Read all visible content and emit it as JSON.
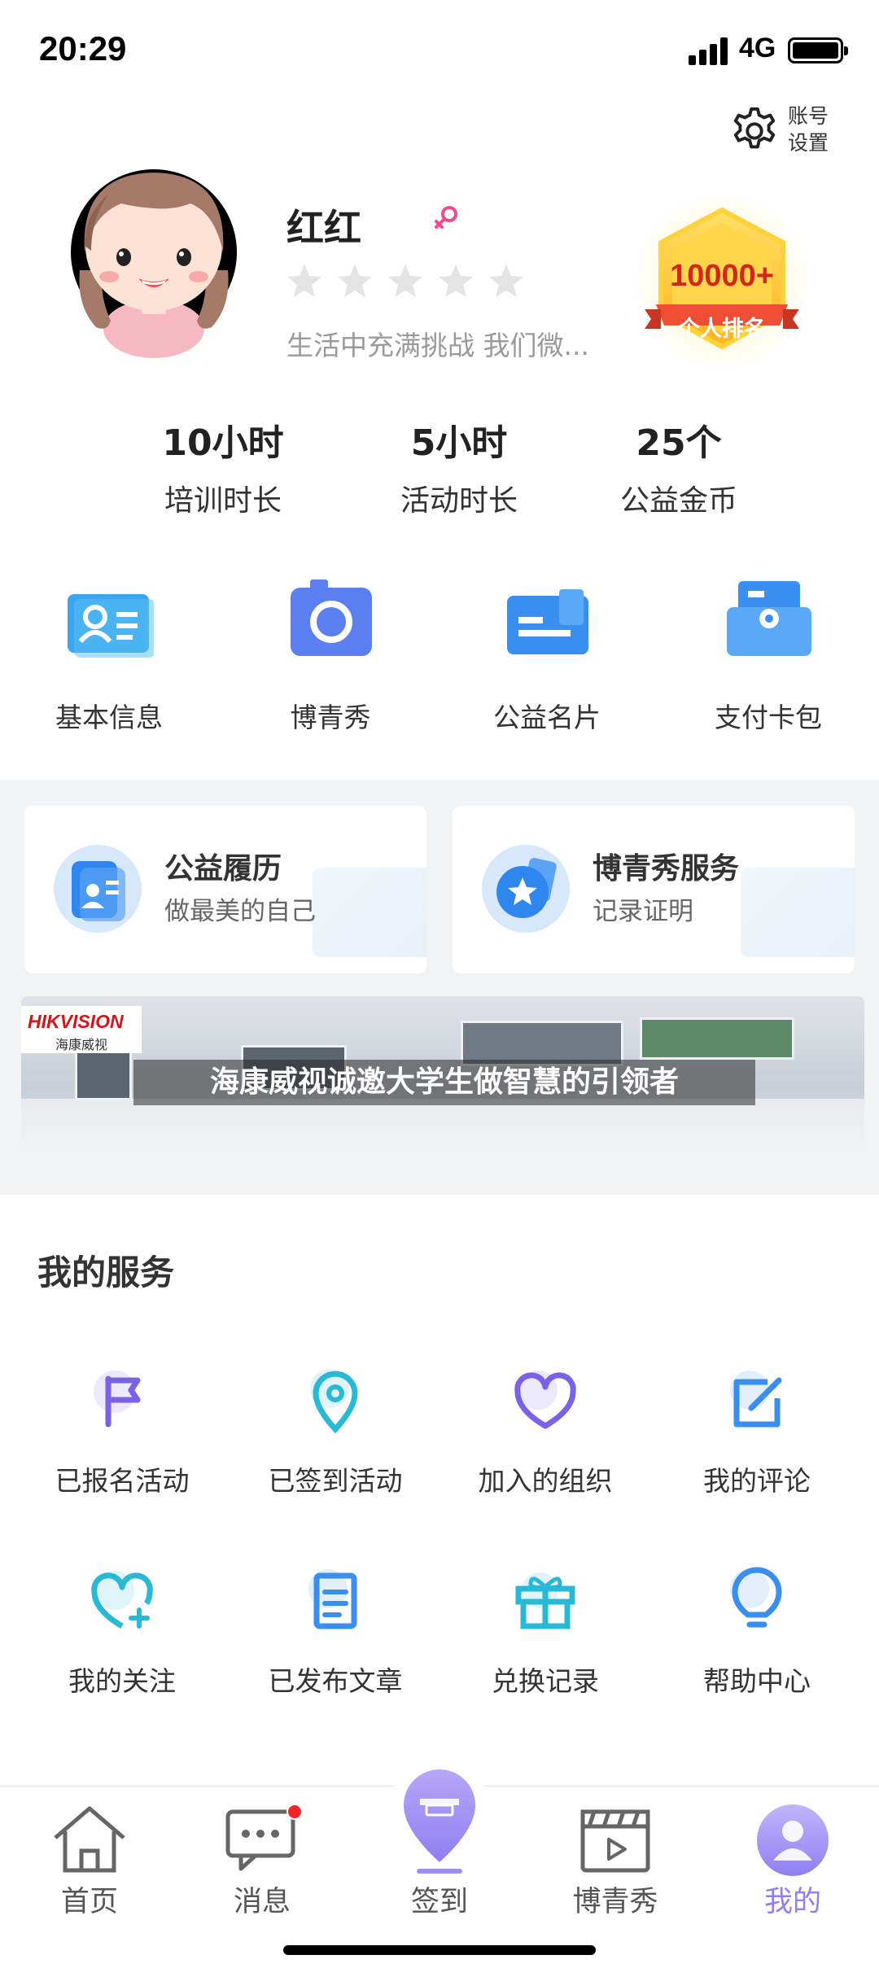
{
  "status_bar": {
    "time": "20:29",
    "network": "4G"
  },
  "settings": {
    "label_line1": "账号",
    "label_line2": "设置"
  },
  "profile": {
    "name": "红红",
    "rating": 0,
    "rating_max": 5,
    "motto": "生活中充满挑战  我们微...",
    "rank_value": "10000+",
    "rank_label": "个人排名"
  },
  "stats": [
    {
      "value": "10小时",
      "label": "培训时长"
    },
    {
      "value": "5小时",
      "label": "活动时长"
    },
    {
      "value": "25个",
      "label": "公益金币"
    }
  ],
  "quick_links": [
    {
      "label": "基本信息",
      "icon": "id-card-icon"
    },
    {
      "label": "博青秀",
      "icon": "camera-icon"
    },
    {
      "label": "公益名片",
      "icon": "card-icon"
    },
    {
      "label": "支付卡包",
      "icon": "wallet-icon"
    }
  ],
  "cards": [
    {
      "title": "公益履历",
      "subtitle": "做最美的自己",
      "icon": "resume-icon"
    },
    {
      "title": "博青秀服务",
      "subtitle": "记录证明",
      "icon": "certificate-icon"
    }
  ],
  "banner": {
    "brand": "HIKVISION",
    "brand_cn": "海康威视",
    "caption": "海康威视诚邀大学生做智慧的引领者"
  },
  "services": {
    "title": "我的服务",
    "items": [
      {
        "label": "已报名活动",
        "icon": "flag-icon"
      },
      {
        "label": "已签到活动",
        "icon": "location-pin-icon"
      },
      {
        "label": "加入的组织",
        "icon": "heart-icon"
      },
      {
        "label": "我的评论",
        "icon": "edit-icon"
      },
      {
        "label": "我的关注",
        "icon": "heart-plus-icon"
      },
      {
        "label": "已发布文章",
        "icon": "document-icon"
      },
      {
        "label": "兑换记录",
        "icon": "gift-icon"
      },
      {
        "label": "帮助中心",
        "icon": "lightbulb-icon"
      }
    ]
  },
  "tabbar": {
    "items": [
      {
        "label": "首页",
        "icon": "home-icon"
      },
      {
        "label": "消息",
        "icon": "message-icon"
      },
      {
        "label": "签到",
        "icon": "checkin-icon"
      },
      {
        "label": "博青秀",
        "icon": "clapperboard-icon"
      },
      {
        "label": "我的",
        "icon": "profile-icon"
      }
    ],
    "active": "我的"
  },
  "colors": {
    "accent": "#8f7ff0",
    "blue": "#3a8ef0",
    "cyan": "#27b9d6",
    "rank_red": "#d3261c",
    "gold": "#ffc52e"
  }
}
